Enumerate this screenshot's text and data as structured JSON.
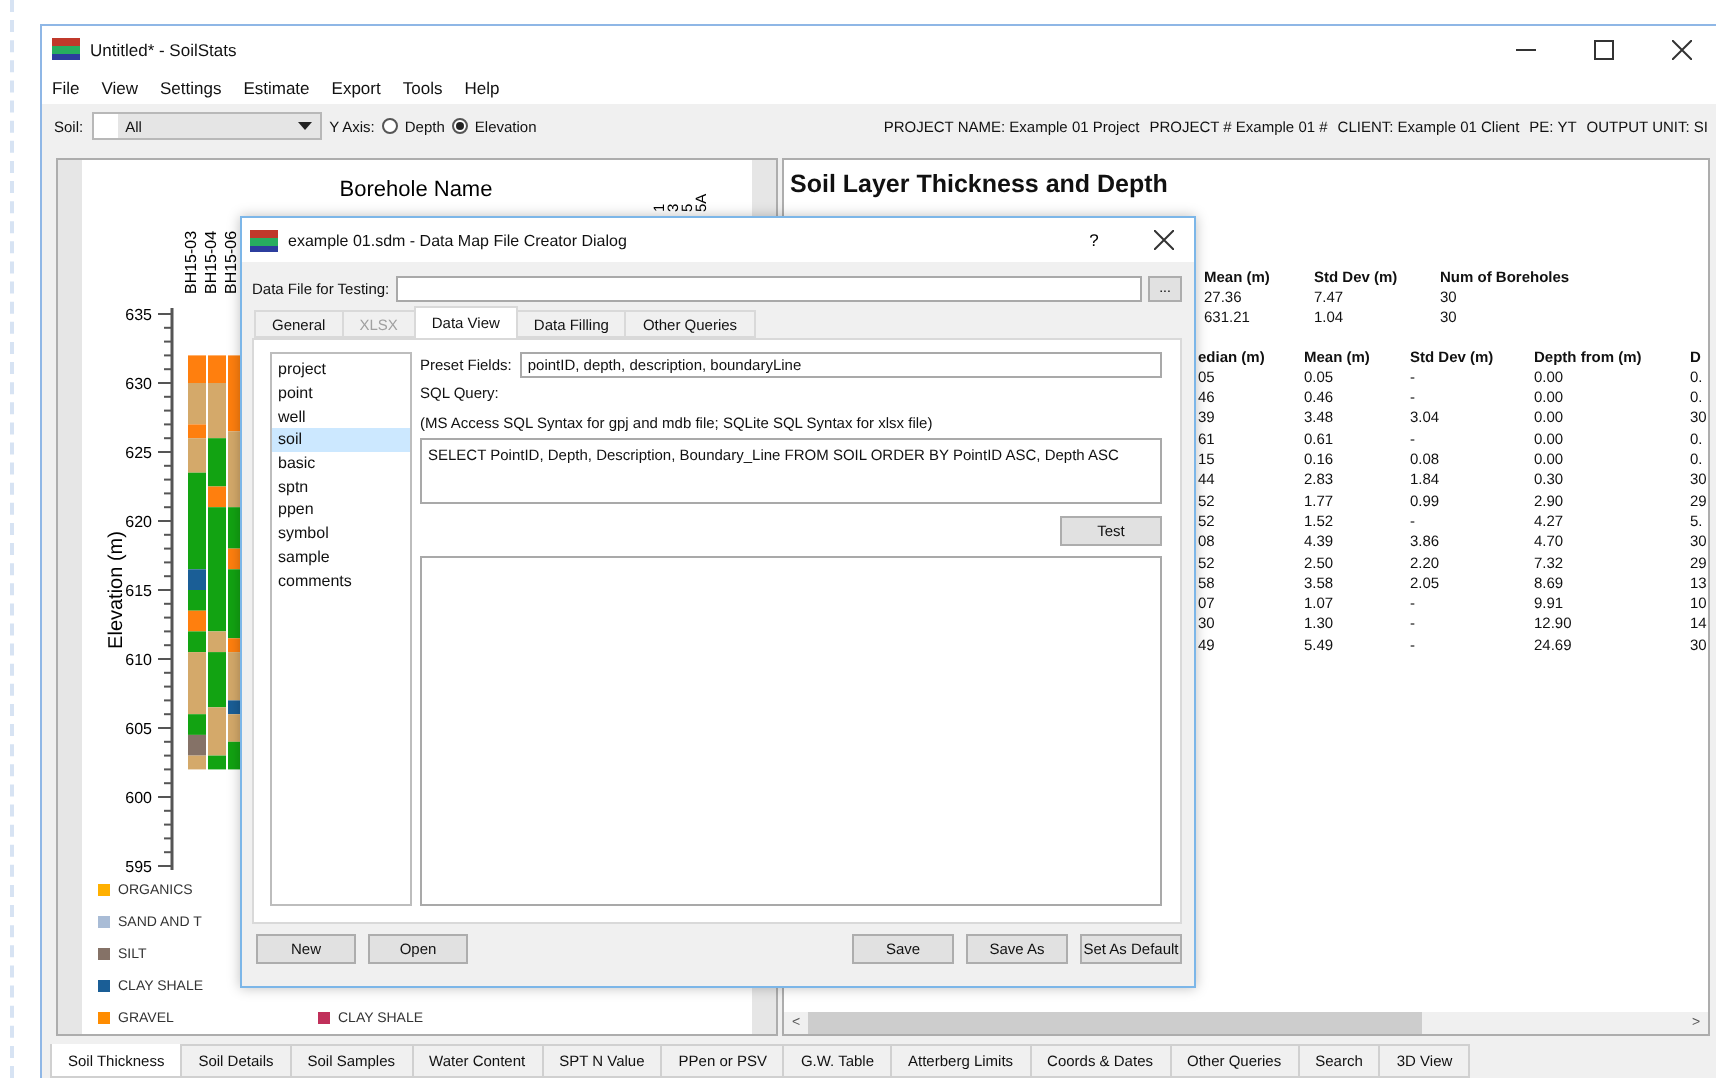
{
  "window": {
    "title": "Untitled* - SoilStats"
  },
  "menu": [
    "File",
    "View",
    "Settings",
    "Estimate",
    "Export",
    "Tools",
    "Help"
  ],
  "toolbar": {
    "soil_label": "Soil:",
    "soil_value": "All",
    "y_axis_label": "Y Axis:",
    "y_axis_options": [
      {
        "label": "Depth",
        "selected": false
      },
      {
        "label": "Elevation",
        "selected": true
      }
    ]
  },
  "project_info": [
    "PROJECT NAME: Example 01 Project",
    "PROJECT # Example 01 #",
    "CLIENT: Example 01 Client",
    "PE: YT",
    "OUTPUT UNIT: SI"
  ],
  "borehole_chart": {
    "title": "Borehole Name",
    "ylabel": "Elevation (m)",
    "yticks": [
      "635",
      "630",
      "625",
      "620",
      "615",
      "610",
      "605",
      "600",
      "595"
    ],
    "boreholes": [
      "BH15-03",
      "BH15-04",
      "BH15-06"
    ],
    "partial_labels": [
      "1",
      "3",
      "5",
      "5A"
    ]
  },
  "legend": [
    {
      "label": "ORGANICS",
      "color": "#ffb000"
    },
    {
      "label": "SAND AND T",
      "color": "#a9bcd6"
    },
    {
      "label": "SILT",
      "color": "#857267"
    },
    {
      "label": "CLAY SHALE",
      "color": "#1a5e96"
    },
    {
      "label": "GRAVEL",
      "color": "#ff8c00"
    },
    {
      "label": "CLAY SHALE",
      "color": "#c0305a"
    }
  ],
  "report": {
    "title": "Soil Layer Thickness and Depth",
    "summary": {
      "columns": [
        "Mean (m)",
        "Std Dev (m)",
        "Num of Boreholes"
      ],
      "rows": [
        [
          "27.36",
          "7.47",
          "30"
        ],
        [
          "631.21",
          "1.04",
          "30"
        ]
      ]
    },
    "layers": {
      "columns": [
        "edian (m)",
        "Mean (m)",
        "Std Dev (m)",
        "Depth from (m)",
        "D"
      ],
      "rows": [
        [
          "05",
          "0.05",
          "-",
          "0.00",
          "0."
        ],
        [
          "46",
          "0.46",
          "-",
          "0.00",
          "0."
        ],
        [
          "39",
          "3.48",
          "3.04",
          "0.00",
          "30"
        ],
        [
          "61",
          "0.61",
          "-",
          "0.00",
          "0."
        ],
        [
          "15",
          "0.16",
          "0.08",
          "0.00",
          "0."
        ],
        [
          "44",
          "2.83",
          "1.84",
          "0.30",
          "30"
        ],
        [
          "52",
          "1.77",
          "0.99",
          "2.90",
          "29"
        ],
        [
          "52",
          "1.52",
          "-",
          "4.27",
          "5."
        ],
        [
          "08",
          "4.39",
          "3.86",
          "4.70",
          "30"
        ],
        [
          "52",
          "2.50",
          "2.20",
          "7.32",
          "29"
        ],
        [
          "58",
          "3.58",
          "2.05",
          "8.69",
          "13"
        ],
        [
          "07",
          "1.07",
          "-",
          "9.91",
          "10"
        ],
        [
          "30",
          "1.30",
          "-",
          "12.90",
          "14"
        ],
        [
          "49",
          "5.49",
          "-",
          "24.69",
          "30"
        ]
      ]
    }
  },
  "scrollbar": {
    "left": "<",
    "right": ">"
  },
  "bottom_tabs": [
    {
      "label": "Soil Thickness",
      "selected": true
    },
    {
      "label": "Soil Details",
      "selected": false
    },
    {
      "label": "Soil Samples",
      "selected": false
    },
    {
      "label": "Water Content",
      "selected": false
    },
    {
      "label": "SPT N Value",
      "selected": false
    },
    {
      "label": "PPen or PSV",
      "selected": false
    },
    {
      "label": "G.W. Table",
      "selected": false
    },
    {
      "label": "Atterberg Limits",
      "selected": false
    },
    {
      "label": "Coords & Dates",
      "selected": false
    },
    {
      "label": "Other Queries",
      "selected": false
    },
    {
      "label": "Search",
      "selected": false
    },
    {
      "label": "3D View",
      "selected": false
    }
  ],
  "dialog": {
    "title": "example 01.sdm - Data Map File Creator Dialog",
    "help": "?",
    "data_file_label": "Data File for Testing:",
    "browse": "...",
    "tabs": [
      {
        "label": "General",
        "selected": false,
        "disabled": false
      },
      {
        "label": "XLSX",
        "selected": false,
        "disabled": true
      },
      {
        "label": "Data View",
        "selected": true,
        "disabled": false
      },
      {
        "label": "Data Filling",
        "selected": false,
        "disabled": false
      },
      {
        "label": "Other Queries",
        "selected": false,
        "disabled": false
      }
    ],
    "tables": [
      {
        "label": "project",
        "selected": false
      },
      {
        "label": "point",
        "selected": false
      },
      {
        "label": "well",
        "selected": false
      },
      {
        "label": "soil",
        "selected": true
      },
      {
        "label": "basic",
        "selected": false
      },
      {
        "label": "sptn",
        "selected": false
      },
      {
        "label": "ppen",
        "selected": false
      },
      {
        "label": "symbol",
        "selected": false
      },
      {
        "label": "sample",
        "selected": false
      },
      {
        "label": "comments",
        "selected": false
      }
    ],
    "preset_label": "Preset Fields:",
    "preset_value": "pointID, depth, description, boundaryLine",
    "sql_label": "SQL Query:",
    "sql_note": "(MS Access SQL Syntax for gpj and mdb file; SQLite SQL Syntax for xlsx file)",
    "sql_value": "SELECT PointID, Depth, Description, Boundary_Line FROM SOIL ORDER BY PointID ASC, Depth ASC",
    "test_button": "Test",
    "left_buttons": [
      "New",
      "Open"
    ],
    "right_buttons": [
      "Save",
      "Save As",
      "Set As Default"
    ]
  }
}
